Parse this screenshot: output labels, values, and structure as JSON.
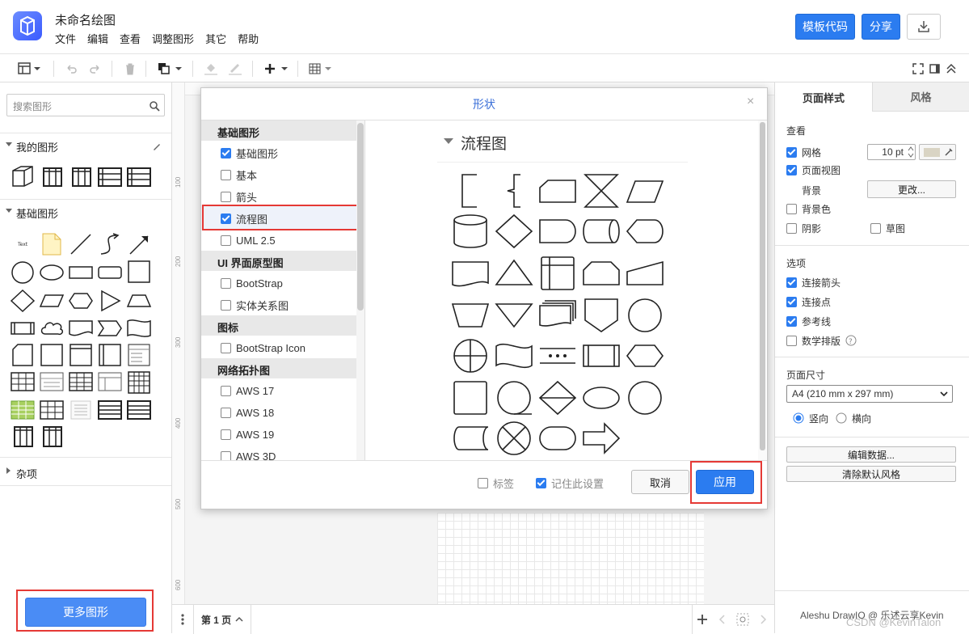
{
  "header": {
    "title": "未命名绘图",
    "menu": [
      "文件",
      "编辑",
      "查看",
      "调整图形",
      "其它",
      "帮助"
    ],
    "template_btn": "模板代码",
    "share_btn": "分享"
  },
  "left": {
    "search_placeholder": "搜索图形",
    "sections": {
      "mine": "我的图形",
      "basic": "基础图形",
      "misc": "杂项"
    },
    "text_shape_label": "Text",
    "more_btn": "更多图形"
  },
  "rulers": {
    "v": [
      "100",
      "200",
      "300",
      "400",
      "500",
      "600"
    ]
  },
  "bottom": {
    "page_tab": "第 1 页"
  },
  "right": {
    "tabs": [
      "页面样式",
      "风格"
    ],
    "view_title": "查看",
    "grid": "网格",
    "grid_size": "10 pt",
    "page_view": "页面视图",
    "background": "背景",
    "change": "更改...",
    "bg_color": "背景色",
    "shadow": "阴影",
    "sketch": "草图",
    "options_title": "选项",
    "connect_arrows": "连接箭头",
    "connect_points": "连接点",
    "guides": "参考线",
    "math": "数学排版",
    "page_size_title": "页面尺寸",
    "page_size": "A4 (210 mm x 297 mm)",
    "portrait": "竖向",
    "landscape": "横向",
    "edit_data": "编辑数据...",
    "clear_style": "清除默认风格",
    "credit": "Aleshu DrawIO @ 乐述云享Kevin"
  },
  "dialog": {
    "title": "形状",
    "categories": [
      "基础图形",
      "UI 界面原型图",
      "图标",
      "网络拓扑图"
    ],
    "options": {
      "basic_shapes": "基础图形",
      "basic": "基本",
      "arrows": "箭头",
      "flowchart": "流程图",
      "uml": "UML 2.5",
      "bootstrap": "BootStrap",
      "er": "实体关系图",
      "bs_icon": "BootStrap Icon",
      "aws17": "AWS 17",
      "aws18": "AWS 18",
      "aws19": "AWS 19",
      "aws3d": "AWS 3D"
    },
    "preview_title": "流程图",
    "label_opt": "标签",
    "remember": "记住此设置",
    "cancel": "取消",
    "apply": "应用"
  },
  "watermark": "CSDN @KevinTalon",
  "colors": {
    "accent": "#2b7cf0",
    "highlight": "#e53935"
  }
}
